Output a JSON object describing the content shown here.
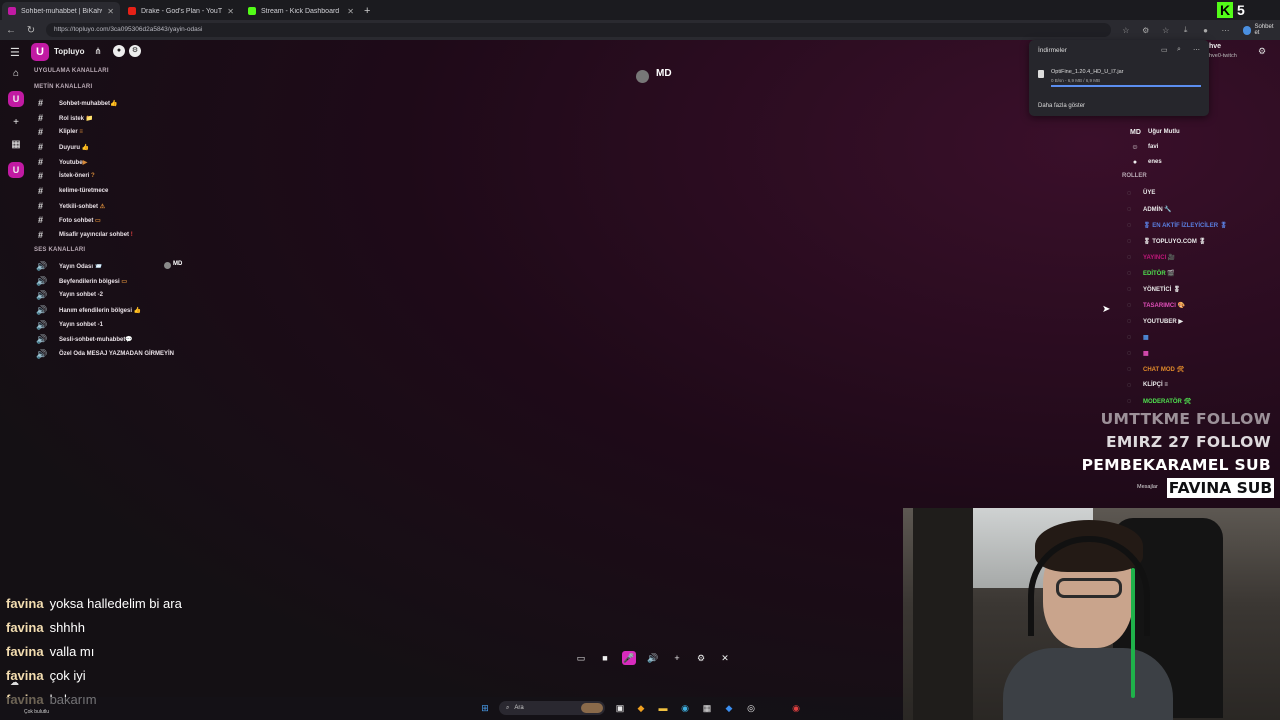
{
  "browser": {
    "tabs": [
      {
        "label": "Sohbet-muhabbet | BiKahv...",
        "color": "#c11aa3",
        "active": true
      },
      {
        "label": "Drake - God's Plan - YouTube",
        "color": "#e62117",
        "active": false
      },
      {
        "label": "Stream - Kick Dashboard",
        "color": "#53fc18",
        "active": false
      }
    ],
    "url": "https://topluyo.com/3ca095306d2a5843/yayin-odasi",
    "kick_logo": "K",
    "kick_count": "5",
    "chat_button": "Sohbet et"
  },
  "app": {
    "name": "Topluyo",
    "logo_glyph": "U"
  },
  "channels": {
    "app_channels_heading": "UYGULAMA KANALLARI",
    "text_heading": "METİN KANALLARI",
    "text": [
      {
        "label": "Sohbet-muhabbet",
        "tag": "👍"
      },
      {
        "label": "Rol istek",
        "tag": "📁"
      },
      {
        "label": "Klipler",
        "tag": "≡"
      },
      {
        "label": "Duyuru",
        "tag": "👍"
      },
      {
        "label": "Youtube",
        "tag": "▶"
      },
      {
        "label": "İstek-öneri",
        "tag": "?"
      },
      {
        "label": "kelime-türetmece",
        "tag": ""
      },
      {
        "label": "Yetkili-sohbet",
        "tag": "⚠"
      },
      {
        "label": "Foto sohbet",
        "tag": "▭"
      },
      {
        "label": "Misafir yayıncılar sohbet",
        "tag": "!"
      }
    ],
    "voice_heading": "SES KANALLARI",
    "voice": [
      {
        "label": "Yayın Odası",
        "tag": "📨"
      },
      {
        "label": "Beyfendilerin bölgesi",
        "tag": "▭"
      },
      {
        "label": "Yayın sohbet -2",
        "tag": ""
      },
      {
        "label": "Hanım efendilerin bölgesi",
        "tag": "👍"
      },
      {
        "label": "Yayın sohbet -1",
        "tag": ""
      },
      {
        "label": "Sesli-sohbet-muhabbet",
        "tag": "💬"
      },
      {
        "label": "Özel Oda MESAJ YAZMADAN GİRMEYİN",
        "tag": ""
      }
    ],
    "voice_user_badge": "MD"
  },
  "center": {
    "user_badge": "MD"
  },
  "downloads": {
    "title": "İndirmeler",
    "file": "OptiFine_1.20.4_HD_U_I7.jar",
    "size": "0 B/sn - 6,9 MB / 6,9 MB",
    "progress": 1.0,
    "show_more": "Daha fazla göster"
  },
  "user": {
    "name_partial": "hve",
    "sub_partial": "hve0-twitch"
  },
  "members": [
    {
      "label": "Uğur Mutlu",
      "avatar": "MD"
    },
    {
      "label": "favi",
      "avatar": "☺"
    },
    {
      "label": "enes",
      "avatar": "●"
    }
  ],
  "roles": {
    "heading": "ROLLER",
    "items": [
      {
        "label": "ÜYE",
        "color": "#e8e8e8"
      },
      {
        "label": "ADMİN 🔧",
        "color": "#e8e8e8"
      },
      {
        "label": "🎖 EN AKTİF İZLEYİCİLER 🎖",
        "color": "#5a7fe0"
      },
      {
        "label": "🎖 TOPLUYO.COM 🎖",
        "color": "#e8e8e8"
      },
      {
        "label": "YAYINCI 🎥",
        "color": "#c0187a"
      },
      {
        "label": "EDİTÖR 🎬",
        "color": "#4fe04f"
      },
      {
        "label": "YÖNETİCİ 🎖",
        "color": "#e8e8e8"
      },
      {
        "label": "TASARIMCI 🎨",
        "color": "#e04fb8"
      },
      {
        "label": "YOUTUBER ▶",
        "color": "#e8e8e8"
      },
      {
        "label": "▦",
        "color": "#4f8fe0"
      },
      {
        "label": "▦",
        "color": "#e04fb8"
      },
      {
        "label": "CHAT MOD 🛠",
        "color": "#e08a2a"
      },
      {
        "label": "KLİPÇİ ≡",
        "color": "#e8e8e8"
      },
      {
        "label": "MODERATÖR 🛠",
        "color": "#4fe04f"
      }
    ]
  },
  "overlay": {
    "follows": [
      "UMTTKME FOLLOW",
      "EMIRZ 27 FOLLOW",
      "PEMBEKARAMEL SUB"
    ],
    "last_sub": "FAVINA SUB",
    "messages_label": "Mesajlar"
  },
  "chat": [
    {
      "user": "favina",
      "text": "yoksa halledelim bi ara"
    },
    {
      "user": "favina",
      "text": "shhhh"
    },
    {
      "user": "favina",
      "text": "valla mı"
    },
    {
      "user": "favina",
      "text": "çok iyi"
    },
    {
      "user": "favina",
      "text": "bakarım"
    }
  ],
  "taskbar": {
    "search": "Ara",
    "weather": "Çok bulutlu"
  }
}
